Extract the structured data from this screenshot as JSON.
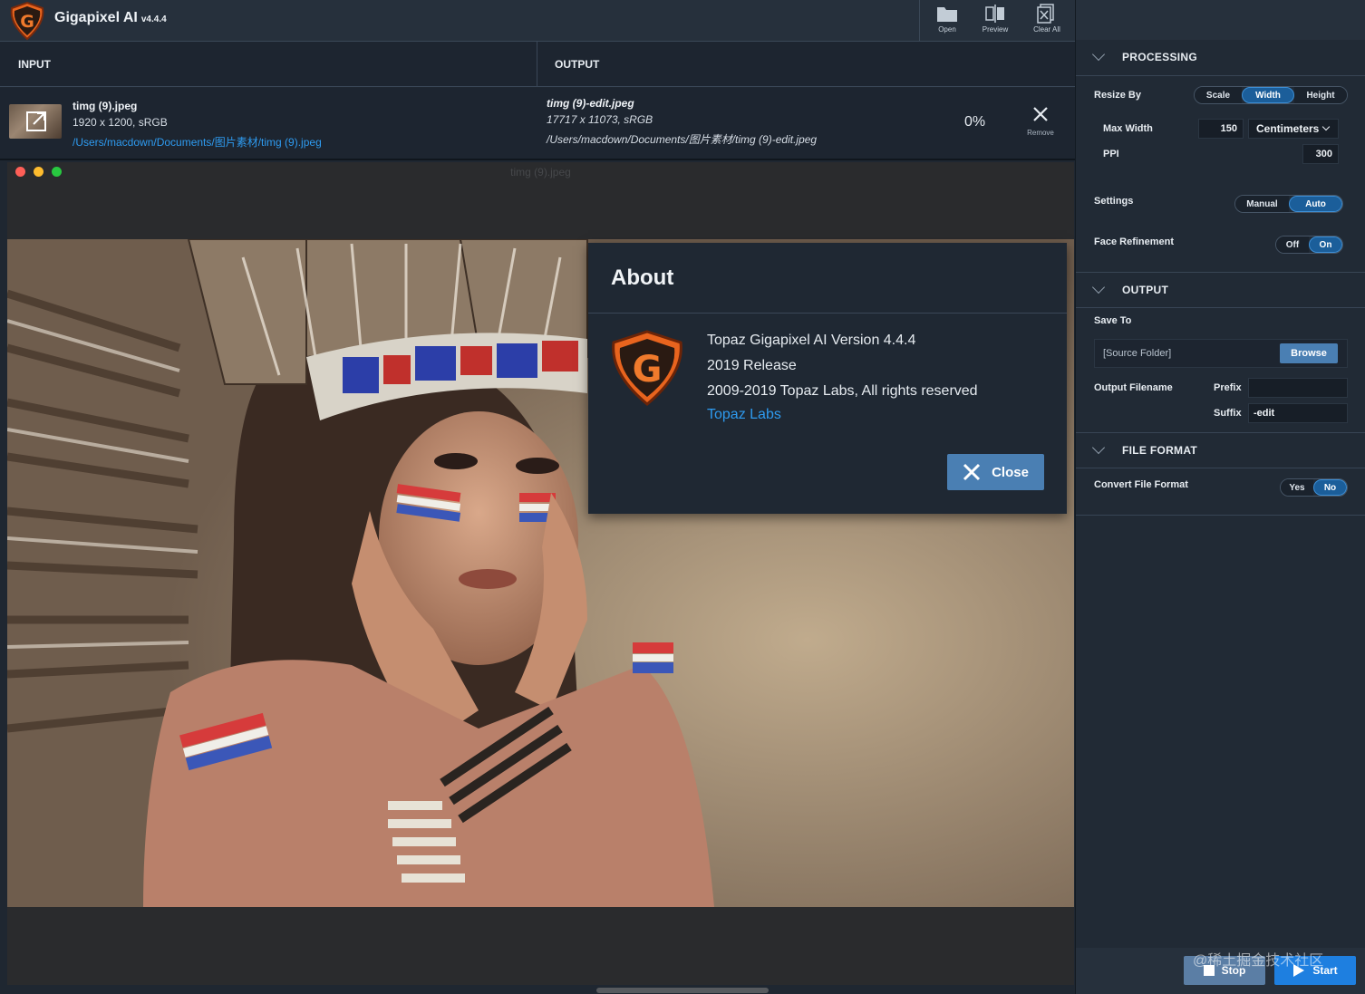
{
  "app": {
    "name": "Gigapixel AI",
    "version": "v4.4.4"
  },
  "toolbar": {
    "open": "Open",
    "preview": "Preview",
    "clear_all": "Clear All"
  },
  "list": {
    "input_header": "INPUT",
    "output_header": "OUTPUT",
    "input_file": {
      "name": "timg (9).jpeg",
      "dims": "1920 x 1200, sRGB",
      "path": "/Users/macdown/Documents/图片素材/timg (9).jpeg"
    },
    "output_file": {
      "name": "timg (9)-edit.jpeg",
      "dims": "17717 x 11073, sRGB",
      "path": "/Users/macdown/Documents/图片素材/timg (9)-edit.jpeg"
    },
    "progress": "0%",
    "remove_label": "Remove"
  },
  "preview": {
    "title": "timg (9).jpeg"
  },
  "about": {
    "title": "About",
    "line1": "Topaz Gigapixel AI Version 4.4.4",
    "line2": "2019 Release",
    "line3": "2009-2019 Topaz Labs, All rights reserved",
    "link": "Topaz Labs",
    "close": "Close"
  },
  "processing": {
    "header": "PROCESSING",
    "resize_by_label": "Resize By",
    "resize_options": [
      "Scale",
      "Width",
      "Height"
    ],
    "resize_selected": "Width",
    "max_width_label": "Max Width",
    "max_width_value": "150",
    "unit": "Centimeters",
    "ppi_label": "PPI",
    "ppi_value": "300",
    "settings_label": "Settings",
    "settings_options": [
      "Manual",
      "Auto"
    ],
    "settings_selected": "Auto",
    "face_label": "Face Refinement",
    "face_options": [
      "Off",
      "On"
    ],
    "face_selected": "On"
  },
  "output": {
    "header": "OUTPUT",
    "save_to_label": "Save To",
    "save_to_value": "[Source Folder]",
    "browse": "Browse",
    "filename_label": "Output Filename",
    "prefix_label": "Prefix",
    "prefix_value": "",
    "suffix_label": "Suffix",
    "suffix_value": "-edit"
  },
  "file_format": {
    "header": "FILE FORMAT",
    "convert_label": "Convert File Format",
    "options": [
      "Yes",
      "No"
    ],
    "selected": "No"
  },
  "actions": {
    "stop": "Stop",
    "start": "Start"
  },
  "watermark": "@稀土掘金技术社区",
  "colors": {
    "accent": "#1e7fe0",
    "link": "#2e9bf0",
    "logo_orange": "#e8641e",
    "panel_bg": "#212a35"
  }
}
